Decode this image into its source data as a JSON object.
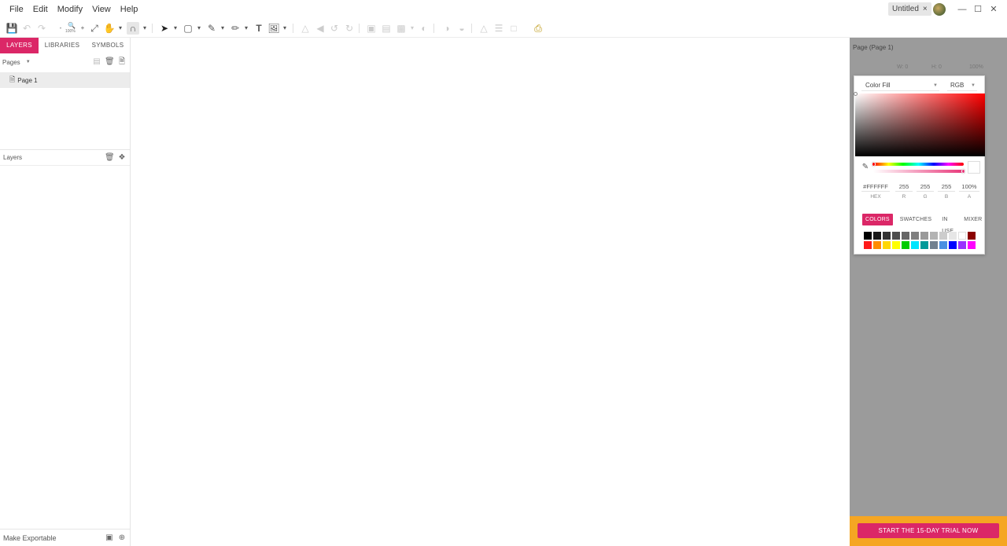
{
  "menubar": {
    "items": [
      "File",
      "Edit",
      "Modify",
      "View",
      "Help"
    ],
    "doc_tab_title": "Untitled",
    "doc_tab_close": "×"
  },
  "window_controls": {
    "minimize": "—",
    "maximize": "☐",
    "close": "✕"
  },
  "toolbar": {
    "zoom_level": "100%"
  },
  "left_panel": {
    "tabs": [
      "LAYERS",
      "LIBRARIES",
      "SYMBOLS"
    ],
    "pages_label": "Pages",
    "pages": [
      {
        "label": "Page 1"
      }
    ],
    "layers_label": "Layers",
    "footer_label": "Make Exportable"
  },
  "right_panel": {
    "title": "Page (Page 1)",
    "w_label": "W: 0",
    "h_label": "H: 0",
    "opacity_value": "100%",
    "cta_label": "START THE 15-DAY TRIAL NOW"
  },
  "color_picker": {
    "fill_type": "Color Fill",
    "color_mode": "RGB",
    "values": [
      {
        "label": "HEX",
        "value": "#FFFFFF"
      },
      {
        "label": "R",
        "value": "255"
      },
      {
        "label": "G",
        "value": "255"
      },
      {
        "label": "B",
        "value": "255"
      },
      {
        "label": "A",
        "value": "100%"
      }
    ],
    "tabs": [
      "COLORS",
      "SWATCHES",
      "IN USE",
      "MIXER"
    ],
    "active_tab": "COLORS",
    "swatches": [
      "#000000",
      "#1a1a1a",
      "#333333",
      "#4d4d4d",
      "#666666",
      "#808080",
      "#999999",
      "#b3b3b3",
      "#cccccc",
      "#e6e6e6",
      "#ffffff",
      "#8b0000",
      "#ff1a1a",
      "#ff8c00",
      "#ffd700",
      "#ffff00",
      "#00cc00",
      "#00e5ff",
      "#009999",
      "#708090",
      "#4a90e2",
      "#0000ff",
      "#9b30ff",
      "#ff00ff"
    ]
  },
  "colors": {
    "accent": "#db2767",
    "right_panel_bg": "#9b9b9b",
    "cta_bar": "#f5a623"
  }
}
